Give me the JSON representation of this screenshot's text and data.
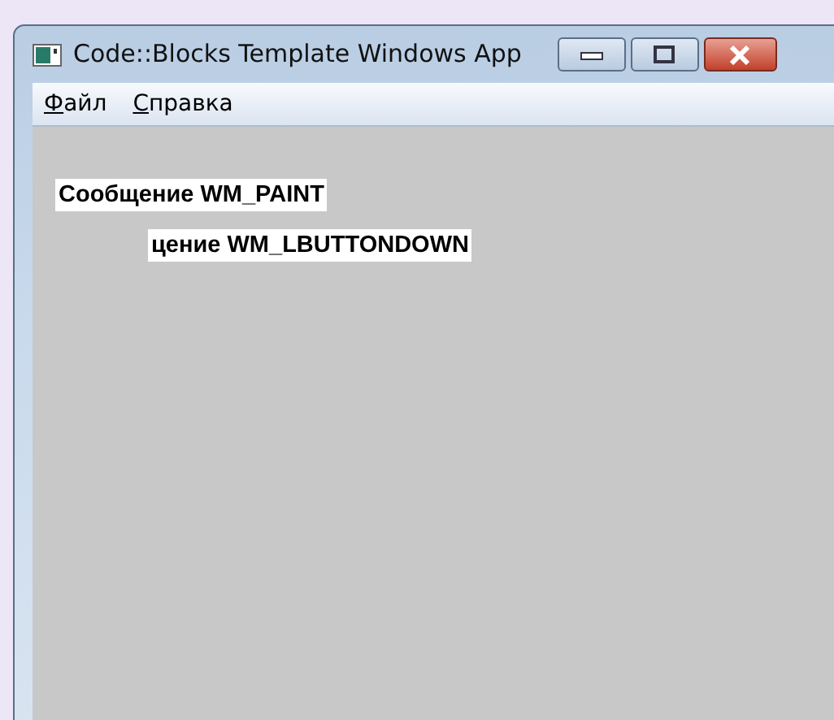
{
  "window": {
    "title": "Code::Blocks Template Windows App"
  },
  "menu": [
    {
      "label": "Файл"
    },
    {
      "label": "Справка"
    }
  ],
  "canvas_texts": [
    {
      "text": "Сообщение WM_PAINT"
    },
    {
      "text": "цение WM_LBUTTONDOWN"
    }
  ]
}
